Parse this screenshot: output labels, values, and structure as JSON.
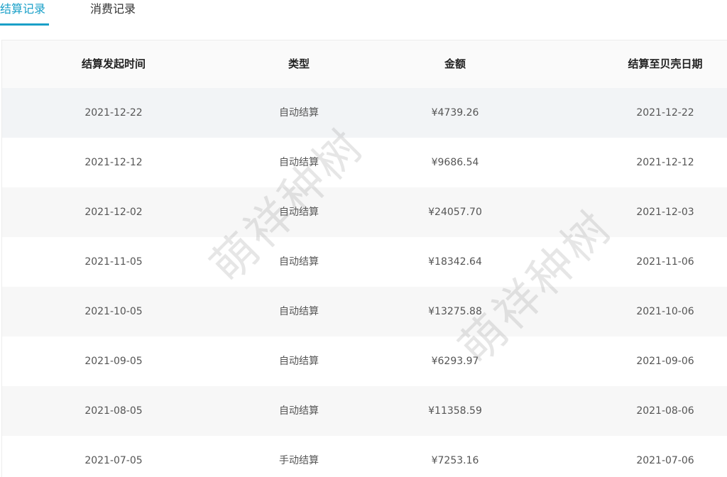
{
  "tabs": [
    {
      "label": "结算记录",
      "active": true
    },
    {
      "label": "消费记录",
      "active": false
    }
  ],
  "accent_color": "#1aa0c8",
  "table": {
    "headers": [
      "结算发起时间",
      "类型",
      "金额",
      "结算至贝壳日期"
    ],
    "rows": [
      [
        "2021-12-22",
        "自动结算",
        "¥4739.26",
        "2021-12-22"
      ],
      [
        "2021-12-12",
        "自动结算",
        "¥9686.54",
        "2021-12-12"
      ],
      [
        "2021-12-02",
        "自动结算",
        "¥24057.70",
        "2021-12-03"
      ],
      [
        "2021-11-05",
        "自动结算",
        "¥18342.64",
        "2021-11-06"
      ],
      [
        "2021-10-05",
        "自动结算",
        "¥13275.88",
        "2021-10-06"
      ],
      [
        "2021-09-05",
        "自动结算",
        "¥6293.97",
        "2021-09-06"
      ],
      [
        "2021-08-05",
        "自动结算",
        "¥11358.59",
        "2021-08-06"
      ],
      [
        "2021-07-05",
        "手动结算",
        "¥7253.16",
        "2021-07-06"
      ]
    ]
  },
  "watermark": "萌祥种树"
}
